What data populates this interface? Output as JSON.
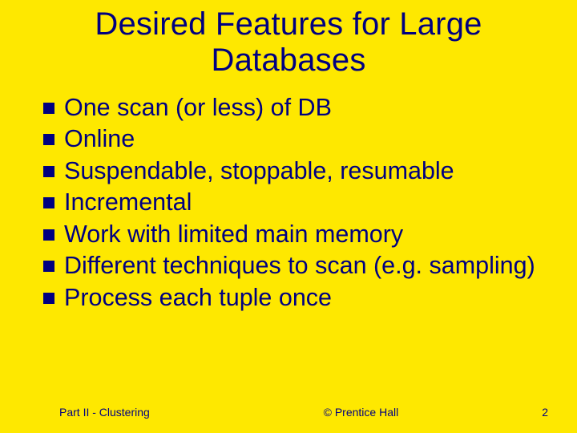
{
  "slide": {
    "title_line1": "Desired Features for Large",
    "title_line2": "Databases",
    "bullets": [
      "One scan (or less) of DB",
      "Online",
      "Suspendable, stoppable, resumable",
      "Incremental",
      "Work with limited main memory",
      "Different techniques to scan (e.g. sampling)",
      "Process each tuple once"
    ],
    "footer_left": "Part II - Clustering",
    "footer_center": "© Prentice Hall",
    "footer_right": "2"
  }
}
